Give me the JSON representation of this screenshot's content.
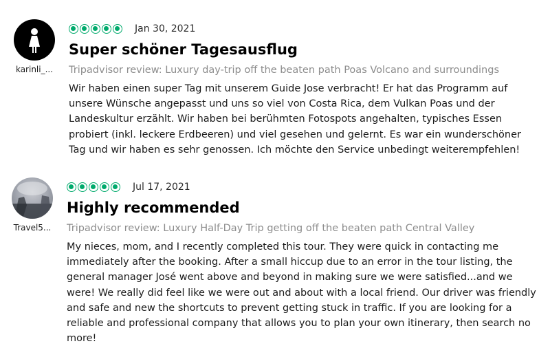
{
  "reviews": [
    {
      "username": "karinli_...",
      "avatar_icon": "female-person-icon",
      "rating": 5,
      "date": "Jan 30, 2021",
      "title": "Super schöner Tagesausflug",
      "source": "Tripadvisor review: Luxury day-trip off the beaten path Poas Volcano and surroundings",
      "body": "Wir haben einen super Tag mit unserem Guide Jose verbracht! Er hat das Programm auf unsere Wünsche angepasst und uns so viel von Costa Rica, dem Vulkan Poas und der Landeskultur erzählt. Wir haben bei berühmten Fotospots angehalten, typisches Essen probiert (inkl. leckere Erdbeeren) und viel gesehen und gelernt. Es war ein wunderschöner Tag und wir haben es sehr genossen. Ich möchte den Service unbedingt weiterempfehlen!"
    },
    {
      "username": "Travel5...",
      "avatar_icon": "photo-avatar",
      "rating": 5,
      "date": "Jul 17, 2021",
      "title": "Highly recommended",
      "source": "Tripadvisor review: Luxury Half-Day Trip getting off the beaten path Central Valley",
      "body": "My nieces, mom, and I recently completed this tour. They were quick in contacting me immediately after the booking. After a small hiccup due to an error in the tour listing, the general manager José went above and beyond in making sure we were satisfied...and we were! We really did feel like we were out and about with a local friend. Our driver was friendly and safe and new the shortcuts to prevent getting stuck in traffic. If you are looking for a reliable and professional company that allows you to plan your own itinerary, then search no more!"
    }
  ],
  "colors": {
    "rating_green": "#00aa6c",
    "source_gray": "#8c8c8c"
  }
}
